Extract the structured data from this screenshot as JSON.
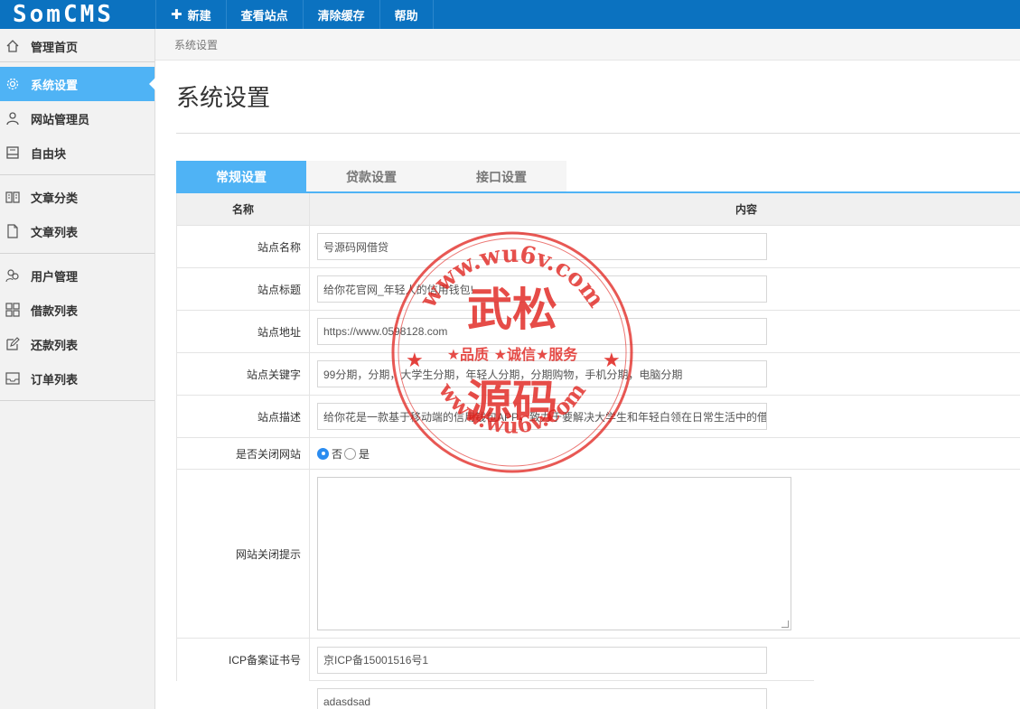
{
  "app": {
    "logo": "SomCMS"
  },
  "topnav": [
    {
      "label": "新建",
      "icon": "plus-icon"
    },
    {
      "label": "查看站点"
    },
    {
      "label": "清除缓存"
    },
    {
      "label": "帮助"
    }
  ],
  "sidebar": {
    "items": [
      {
        "label": "管理首页",
        "icon": "home-icon"
      },
      {
        "label": "系统设置",
        "icon": "gear-icon",
        "active": true
      },
      {
        "label": "网站管理员",
        "icon": "user-icon"
      },
      {
        "label": "自由块",
        "icon": "block-icon"
      },
      {
        "label": "文章分类",
        "icon": "book-icon"
      },
      {
        "label": "文章列表",
        "icon": "file-icon"
      },
      {
        "label": "用户管理",
        "icon": "users-icon"
      },
      {
        "label": "借款列表",
        "icon": "grid-icon"
      },
      {
        "label": "还款列表",
        "icon": "edit-icon"
      },
      {
        "label": "订单列表",
        "icon": "inbox-icon"
      }
    ]
  },
  "breadcrumb": "系统设置",
  "page_title": "系统设置",
  "tabs": [
    {
      "label": "常规设置",
      "active": true
    },
    {
      "label": "贷款设置"
    },
    {
      "label": "接口设置"
    }
  ],
  "form": {
    "header": {
      "name": "名称",
      "content": "内容"
    },
    "site_name": {
      "label": "站点名称",
      "value": "号源码网借贷"
    },
    "site_title": {
      "label": "站点标题",
      "value": "给你花官网_年轻人的信用钱包!"
    },
    "site_url": {
      "label": "站点地址",
      "value": "https://www.0598128.com"
    },
    "site_keywords": {
      "label": "站点关键字",
      "value": "99分期，分期，大学生分期，年轻人分期，分期购物，手机分期，电脑分期"
    },
    "site_desc": {
      "label": "站点描述",
      "value": "给你花是一款基于移动端的信用钱包APP，致力于要解决大学生和年轻白领在日常生活中的借"
    },
    "close_site": {
      "label": "是否关闭网站",
      "options": [
        "否",
        "是"
      ],
      "selected": "否"
    },
    "close_tip": {
      "label": "网站关闭提示",
      "value": ""
    },
    "icp": {
      "label": "ICP备案证书号",
      "value": "京ICP备15001516号1"
    },
    "extra": {
      "value": "adasdsad"
    }
  },
  "watermark": {
    "top_arc": "www.wu6v.com",
    "bottom_arc": "www.wu6v.com",
    "line1": "武松",
    "line2": "★品质 ★诚信★服务",
    "line3": "源码",
    "color": "#e0201b"
  },
  "colors": {
    "topbar": "#0b72c0",
    "accent": "#4fb3f5"
  }
}
